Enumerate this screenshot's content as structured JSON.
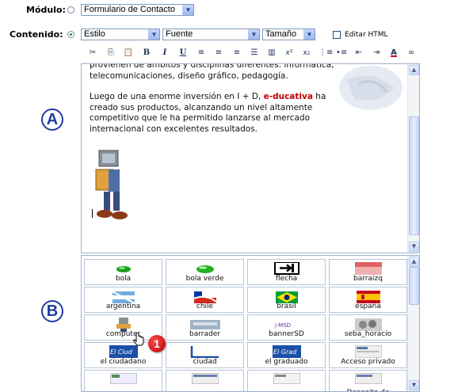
{
  "form": {
    "modulo_label": "Módulo:",
    "modulo_value": "Formulario de Contacto",
    "contenido_label": "Contenido:",
    "estilo_value": "Estilo",
    "fuente_value": "Fuente",
    "tamano_value": "Tamaño",
    "editar_html_label": "Editar HTML"
  },
  "toolbar": {
    "bold": "B",
    "italic": "I",
    "underline": "U",
    "superscript": "x²",
    "subscript": "x₂",
    "font_color": "A"
  },
  "editor": {
    "line1": "provienen de ámbitos y disciplinas diferentes: informática,",
    "line2": "telecomunicaciones, diseño gráfico, pedagogía.",
    "para2_a": "Luego de una enorme inversión en I + D, ",
    "brand": "e-ducativa",
    "para2_b": " ha",
    "line4": "creado sus productos, alcanzando un nivel altamente",
    "line5": "competitivo que le ha permitido lanzarse al mercado",
    "line6": "internacional con excelentes resultados."
  },
  "markers": {
    "a": "A",
    "b": "B",
    "step": "1"
  },
  "gallery": {
    "items": [
      {
        "label": "bola"
      },
      {
        "label": "bola verde"
      },
      {
        "label": "flecha"
      },
      {
        "label": "barraizq"
      },
      {
        "label": "argentina"
      },
      {
        "label": "chile"
      },
      {
        "label": "brasil"
      },
      {
        "label": "españa"
      },
      {
        "label": "computer"
      },
      {
        "label": "barrader"
      },
      {
        "label": "bannerSD"
      },
      {
        "label": "seba_horacio"
      },
      {
        "label": "el ciudadano"
      },
      {
        "label": "ciudad"
      },
      {
        "label": "el graduado"
      },
      {
        "label": "Acceso privado"
      },
      {
        "label": ""
      },
      {
        "label": ""
      },
      {
        "label": ""
      },
      {
        "label": "Deposito de"
      }
    ]
  },
  "colors": {
    "accent": "#1f3fa0",
    "badge": "#cc0000",
    "brand_text": "#c00000"
  }
}
